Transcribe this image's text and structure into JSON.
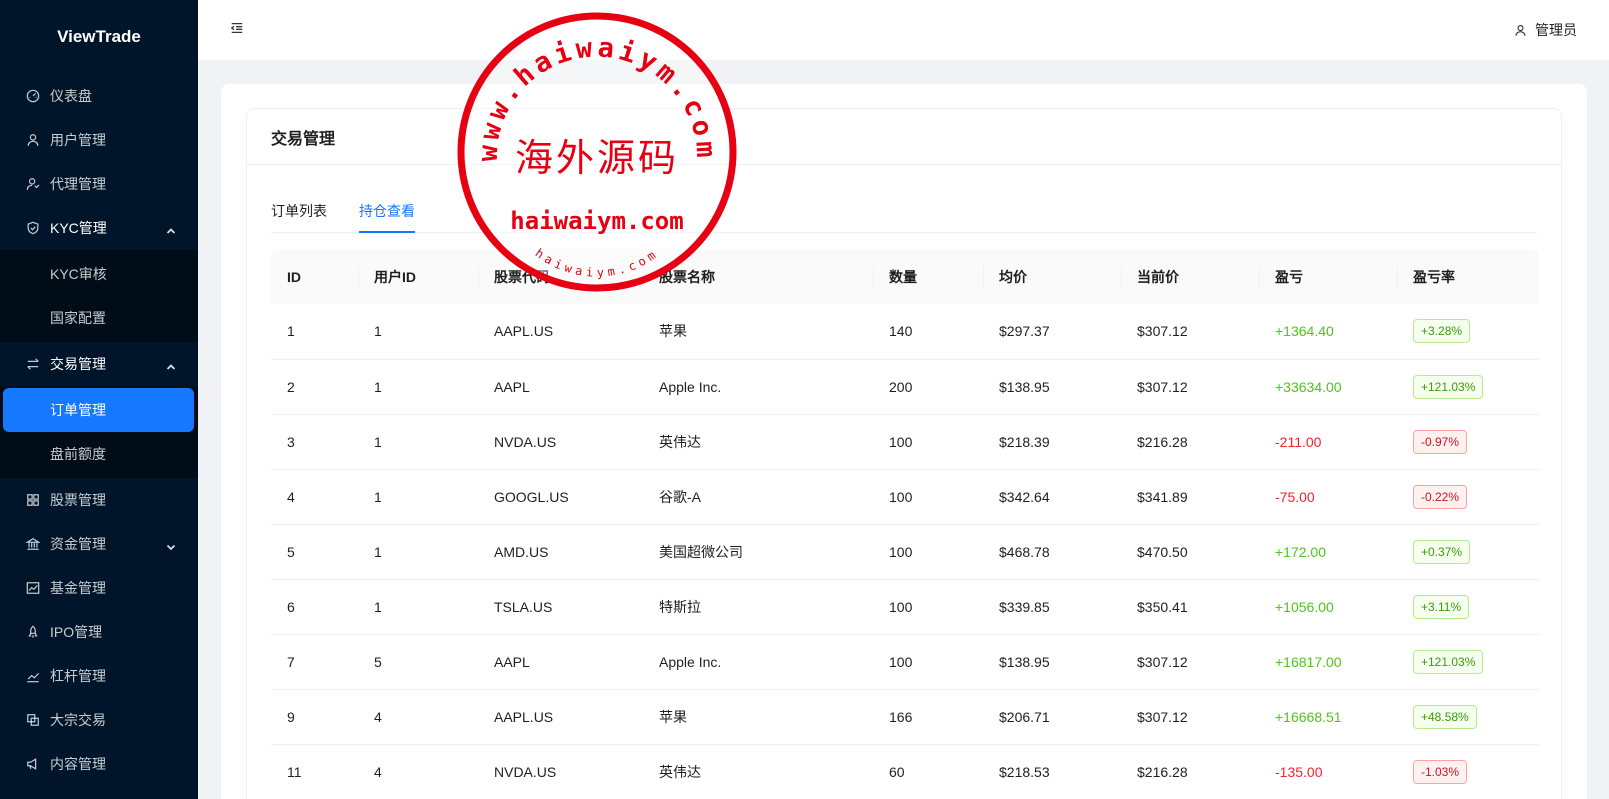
{
  "app": {
    "name": "ViewTrade"
  },
  "sidebar": {
    "items": [
      {
        "label": "仪表盘",
        "icon": "dashboard-icon"
      },
      {
        "label": "用户管理",
        "icon": "user-icon"
      },
      {
        "label": "代理管理",
        "icon": "agent-icon"
      },
      {
        "label": "KYC管理",
        "icon": "shield-icon",
        "expanded": true,
        "children": [
          {
            "label": "KYC审核"
          },
          {
            "label": "国家配置"
          }
        ]
      },
      {
        "label": "交易管理",
        "icon": "swap-icon",
        "expanded": true,
        "children": [
          {
            "label": "订单管理",
            "active": true
          },
          {
            "label": "盘前额度"
          }
        ]
      },
      {
        "label": "股票管理",
        "icon": "grid-icon"
      },
      {
        "label": "资金管理",
        "icon": "bank-icon",
        "expanded": false
      },
      {
        "label": "基金管理",
        "icon": "fund-chart-icon"
      },
      {
        "label": "IPO管理",
        "icon": "rocket-icon"
      },
      {
        "label": "杠杆管理",
        "icon": "line-chart-icon"
      },
      {
        "label": "大宗交易",
        "icon": "block-trade-icon"
      },
      {
        "label": "内容管理",
        "icon": "megaphone-icon"
      }
    ]
  },
  "header": {
    "user_label": "管理员"
  },
  "card": {
    "title": "交易管理"
  },
  "tabs": [
    {
      "label": "订单列表"
    },
    {
      "label": "持仓查看",
      "active": true
    }
  ],
  "table": {
    "columns": [
      "ID",
      "用户ID",
      "股票代码",
      "股票名称",
      "数量",
      "均价",
      "当前价",
      "盈亏",
      "盈亏率"
    ],
    "rows": [
      {
        "id": "1",
        "user_id": "1",
        "code": "AAPL.US",
        "name": "苹果",
        "qty": "140",
        "avg": "$297.37",
        "cur": "$307.12",
        "pnl": "+1364.40",
        "rate": "+3.28%",
        "sign": "pos"
      },
      {
        "id": "2",
        "user_id": "1",
        "code": "AAPL",
        "name": "Apple Inc.",
        "qty": "200",
        "avg": "$138.95",
        "cur": "$307.12",
        "pnl": "+33634.00",
        "rate": "+121.03%",
        "sign": "pos"
      },
      {
        "id": "3",
        "user_id": "1",
        "code": "NVDA.US",
        "name": "英伟达",
        "qty": "100",
        "avg": "$218.39",
        "cur": "$216.28",
        "pnl": "-211.00",
        "rate": "-0.97%",
        "sign": "neg"
      },
      {
        "id": "4",
        "user_id": "1",
        "code": "GOOGL.US",
        "name": "谷歌-A",
        "qty": "100",
        "avg": "$342.64",
        "cur": "$341.89",
        "pnl": "-75.00",
        "rate": "-0.22%",
        "sign": "neg"
      },
      {
        "id": "5",
        "user_id": "1",
        "code": "AMD.US",
        "name": "美国超微公司",
        "qty": "100",
        "avg": "$468.78",
        "cur": "$470.50",
        "pnl": "+172.00",
        "rate": "+0.37%",
        "sign": "pos"
      },
      {
        "id": "6",
        "user_id": "1",
        "code": "TSLA.US",
        "name": "特斯拉",
        "qty": "100",
        "avg": "$339.85",
        "cur": "$350.41",
        "pnl": "+1056.00",
        "rate": "+3.11%",
        "sign": "pos"
      },
      {
        "id": "7",
        "user_id": "5",
        "code": "AAPL",
        "name": "Apple Inc.",
        "qty": "100",
        "avg": "$138.95",
        "cur": "$307.12",
        "pnl": "+16817.00",
        "rate": "+121.03%",
        "sign": "pos"
      },
      {
        "id": "9",
        "user_id": "4",
        "code": "AAPL.US",
        "name": "苹果",
        "qty": "166",
        "avg": "$206.71",
        "cur": "$307.12",
        "pnl": "+16668.51",
        "rate": "+48.58%",
        "sign": "pos"
      },
      {
        "id": "11",
        "user_id": "4",
        "code": "NVDA.US",
        "name": "英伟达",
        "qty": "60",
        "avg": "$218.53",
        "cur": "$216.28",
        "pnl": "-135.00",
        "rate": "-1.03%",
        "sign": "neg"
      }
    ]
  },
  "watermark": {
    "ring_text": "www.haiwaiym.com",
    "center_text": "海外源码",
    "domain_text": "haiwaiym.com",
    "small_text": "haiwaiym.com",
    "color": "#e60012"
  },
  "colors": {
    "sidebar_bg": "#001529",
    "accent": "#1677ff",
    "positive": "#52c41a",
    "negative": "#f5222d"
  }
}
